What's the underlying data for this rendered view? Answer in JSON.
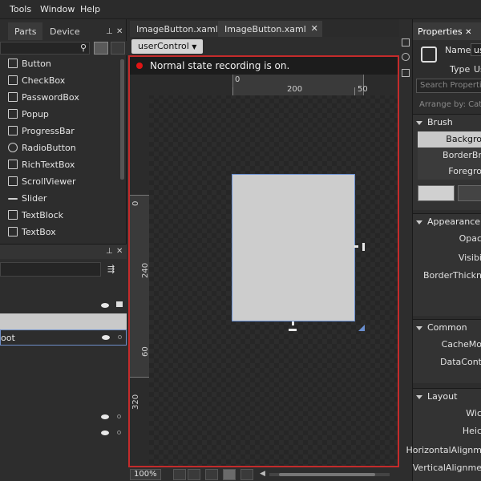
{
  "menu": {
    "items": [
      "Tools",
      "Window",
      "Help"
    ]
  },
  "left_panel": {
    "tabs": [
      "Parts",
      "Device"
    ],
    "assets": [
      {
        "label": "Button",
        "icon": "button-icon"
      },
      {
        "label": "CheckBox",
        "icon": "checkbox-icon"
      },
      {
        "label": "PasswordBox",
        "icon": "passwordbox-icon"
      },
      {
        "label": "Popup",
        "icon": "popup-icon"
      },
      {
        "label": "ProgressBar",
        "icon": "progressbar-icon"
      },
      {
        "label": "RadioButton",
        "icon": "radiobutton-icon"
      },
      {
        "label": "RichTextBox",
        "icon": "richtextbox-icon"
      },
      {
        "label": "ScrollViewer",
        "icon": "scrollviewer-icon"
      },
      {
        "label": "Slider",
        "icon": "slider-icon"
      },
      {
        "label": "TextBlock",
        "icon": "textblock-icon"
      },
      {
        "label": "TextBox",
        "icon": "textbox-icon"
      }
    ],
    "objects": {
      "root_label": "oot"
    }
  },
  "document": {
    "tabs": [
      "ImageButton.xaml.cs",
      "ImageButton.xaml"
    ],
    "breadcrumb": "userControl",
    "recording_text": "Normal state recording is on.",
    "ruler": {
      "h_labels": [
        "0",
        "200",
        "50"
      ],
      "v_labels": [
        "0",
        "240",
        "60",
        "320"
      ]
    },
    "zoom": "100%"
  },
  "properties": {
    "title": "Properties",
    "name_label": "Name",
    "name_value": "us",
    "type_label": "Type",
    "type_value": "Us",
    "search_placeholder": "Search Properties",
    "arrange_by": "Arrange by: Cate",
    "brush": {
      "header": "Brush",
      "rows": [
        "Backgro",
        "BorderBr",
        "Foregro"
      ]
    },
    "appearance": {
      "header": "Appearance",
      "rows": [
        "Opac",
        "Visibi",
        "BorderThickn"
      ]
    },
    "common": {
      "header": "Common",
      "rows": [
        "CacheMo",
        "DataCont"
      ]
    },
    "layout": {
      "header": "Layout",
      "rows": [
        "Wic",
        "Heic",
        "HorizontalAlignm",
        "VerticalAlignme"
      ]
    }
  },
  "colors": {
    "recording_border": "#c42b2b",
    "recording_dot": "#e01414",
    "selection": "#6a8fd0"
  }
}
